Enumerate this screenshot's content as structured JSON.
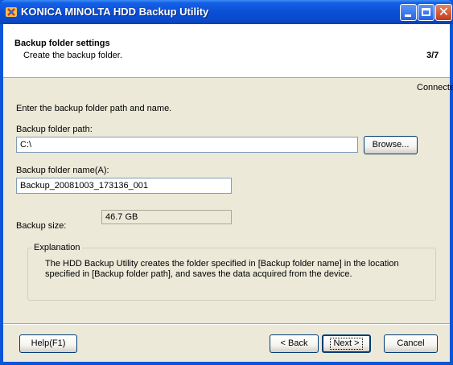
{
  "window": {
    "title": "KONICA MINOLTA HDD Backup Utility",
    "accent": "#0b55d9"
  },
  "header": {
    "title": "Backup folder settings",
    "subtitle": "Create the backup folder.",
    "step": "3/7"
  },
  "status": {
    "connection": "Connected"
  },
  "form": {
    "instruction": "Enter the backup folder path and  name.",
    "path_label": "Backup folder path:",
    "path_value": "C:\\",
    "browse_label": "Browse...",
    "name_label": "Backup folder name(A):",
    "name_value": "Backup_20081003_173136_001",
    "size_label": "Backup size:",
    "size_value": "46.7 GB"
  },
  "explanation": {
    "legend": "Explanation",
    "text": "The HDD Backup Utility creates the folder specified in [Backup folder name] in the location specified in [Backup folder path], and saves the data acquired from the device."
  },
  "buttons": {
    "help": "Help(F1)",
    "back": "< Back",
    "next": "Next >",
    "cancel": "Cancel"
  }
}
